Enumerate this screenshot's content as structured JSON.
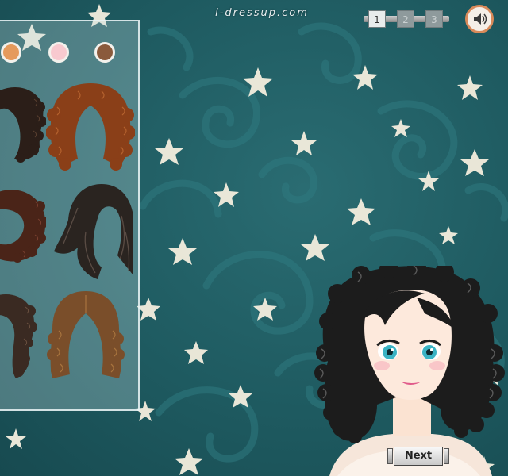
{
  "site": {
    "logo_text": "i-dressup.com"
  },
  "pagination": {
    "pages": [
      "1",
      "2",
      "3"
    ],
    "current": "1"
  },
  "sound": {
    "icon": "speaker-icon"
  },
  "colors": {
    "background": "#1e5a60",
    "swatch_colors": [
      "#e59a5c",
      "#f8c9cf",
      "#8a5a3c"
    ],
    "hair_colors": [
      "#2b1e18",
      "#8a3f18",
      "#4a2418",
      "#2a2420",
      "#3a2a22",
      "#7a4e2a"
    ]
  },
  "buttons": {
    "next": "Next"
  }
}
